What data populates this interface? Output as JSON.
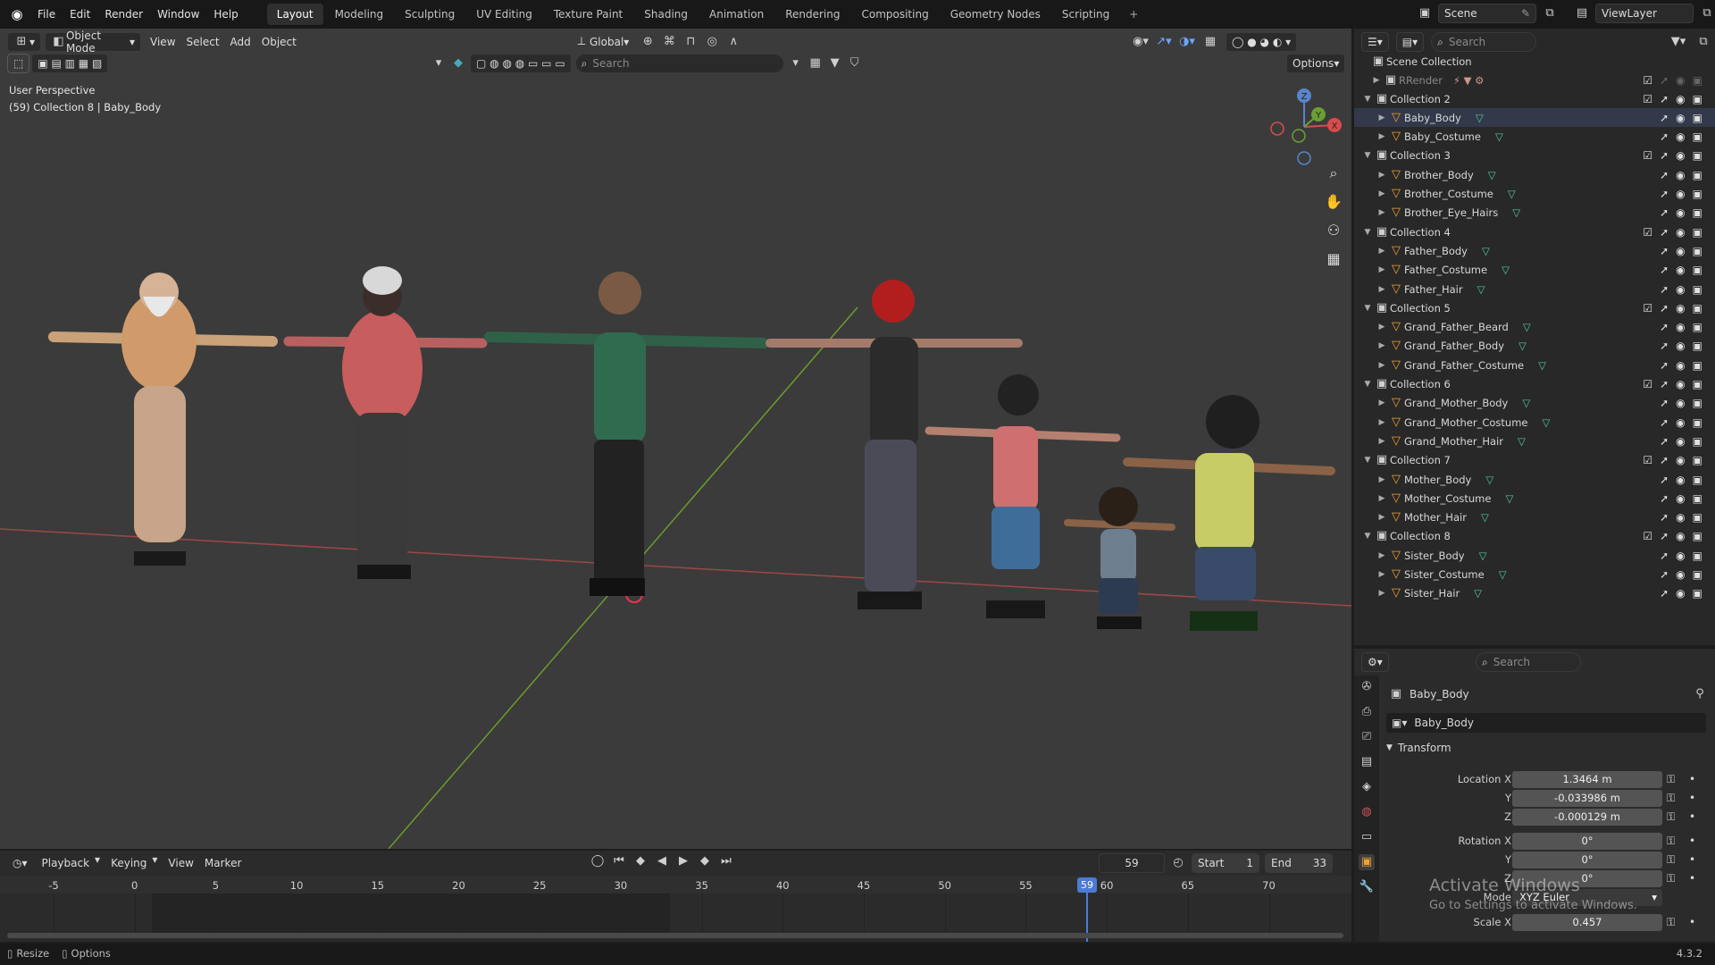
{
  "topbar": {
    "menus": [
      "File",
      "Edit",
      "Render",
      "Window",
      "Help"
    ],
    "workspaces": [
      "Layout",
      "Modeling",
      "Sculpting",
      "UV Editing",
      "Texture Paint",
      "Shading",
      "Animation",
      "Rendering",
      "Compositing",
      "Geometry Nodes",
      "Scripting"
    ],
    "active_workspace": "Layout",
    "add_tab": "+",
    "scene": "Scene",
    "view_layer": "ViewLayer"
  },
  "viewport": {
    "mode": "Object Mode",
    "menus": [
      "View",
      "Select",
      "Add",
      "Object"
    ],
    "orientation": "Global",
    "search_placeholder": "Search",
    "options_label": "Options",
    "overlay_title": "User Perspective",
    "overlay_subtitle": "(59) Collection 8 | Baby_Body",
    "gizmo": {
      "x": "X",
      "y": "Y",
      "z": "Z"
    }
  },
  "outliner": {
    "search_placeholder": "Search",
    "root": "Scene Collection",
    "render_collection": "RRender",
    "collections": [
      {
        "name": "Collection 2",
        "objects": [
          "Baby_Body",
          "Baby_Costume"
        ]
      },
      {
        "name": "Collection 3",
        "objects": [
          "Brother_Body",
          "Brother_Costume",
          "Brother_Eye_Hairs"
        ]
      },
      {
        "name": "Collection 4",
        "objects": [
          "Father_Body",
          "Father_Costume",
          "Father_Hair"
        ]
      },
      {
        "name": "Collection 5",
        "objects": [
          "Grand_Father_Beard",
          "Grand_Father_Body",
          "Grand_Father_Costume"
        ]
      },
      {
        "name": "Collection 6",
        "objects": [
          "Grand_Mother_Body",
          "Grand_Mother_Costume",
          "Grand_Mother_Hair"
        ]
      },
      {
        "name": "Collection 7",
        "objects": [
          "Mother_Body",
          "Mother_Costume",
          "Mother_Hair"
        ]
      },
      {
        "name": "Collection 8",
        "objects": [
          "Sister_Body",
          "Sister_Costume",
          "Sister_Hair"
        ]
      }
    ]
  },
  "properties": {
    "search_placeholder": "Search",
    "object_name": "Baby_Body",
    "datablock_name": "Baby_Body",
    "panel_title": "Transform",
    "location_label": "Location X",
    "location": {
      "x": "1.3464 m",
      "y": "-0.033986 m",
      "z": "-0.000129 m"
    },
    "rotation_label": "Rotation X",
    "rotation": {
      "x": "0°",
      "y": "0°",
      "z": "0°"
    },
    "mode_label": "Mode",
    "mode_value": "XYZ Euler",
    "scale_label": "Scale X",
    "scale_x": "0.457",
    "y_label": "Y",
    "z_label": "Z"
  },
  "timeline": {
    "menus": [
      "Playback",
      "Keying",
      "View",
      "Marker"
    ],
    "current_frame": "59",
    "start_label": "Start",
    "start": "1",
    "end_label": "End",
    "end": "33",
    "ticks": [
      "-5",
      "0",
      "5",
      "10",
      "15",
      "20",
      "25",
      "30",
      "35",
      "40",
      "45",
      "50",
      "55",
      "60",
      "65",
      "70"
    ],
    "playhead": "59"
  },
  "statusbar": {
    "resize": "Resize",
    "options": "Options",
    "version": "4.3.2"
  },
  "watermark": {
    "title": "Activate Windows",
    "subtitle": "Go to Settings to activate Windows."
  }
}
